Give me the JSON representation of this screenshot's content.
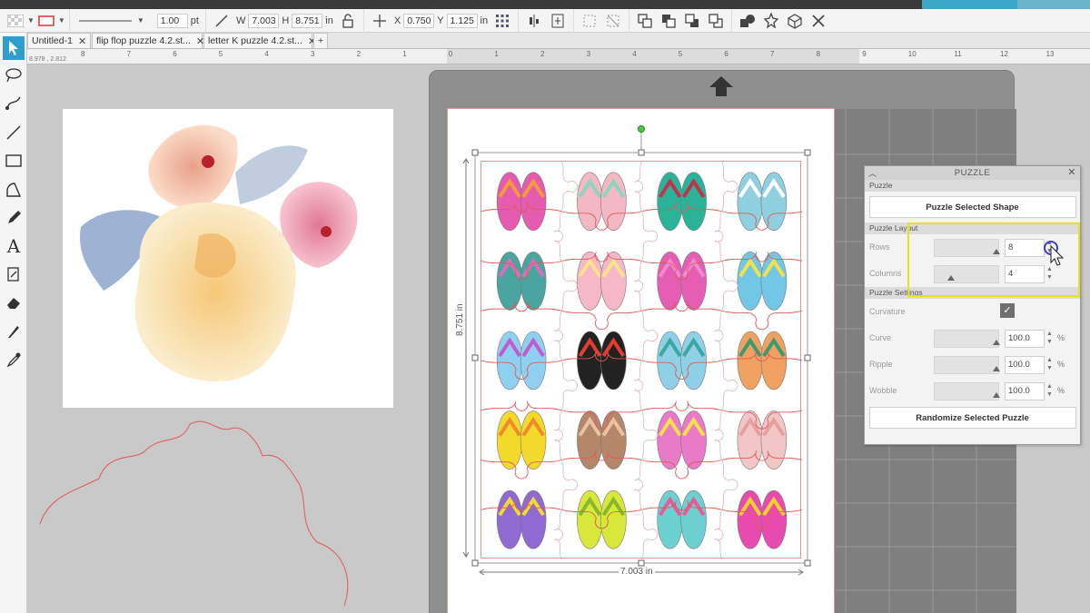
{
  "toolbar": {
    "line_width": "1.00",
    "line_unit": "pt",
    "w_label": "W",
    "w_value": "7.003",
    "h_label": "H",
    "h_value": "8.751",
    "size_unit": "in",
    "x_label": "X",
    "x_value": "0.750",
    "y_label": "Y",
    "y_value": "1.125",
    "pos_unit": "in"
  },
  "tabs": [
    {
      "label": "Untitled-1"
    },
    {
      "label": "flip flop puzzle 4.2.st..."
    },
    {
      "label": "letter K puzzle 4.2.st..."
    }
  ],
  "tab_add": "+",
  "tab_close": "✕",
  "ruler": {
    "coord": "8.978 , 2.812",
    "numbers": [
      "8",
      "7",
      "6",
      "5",
      "4",
      "3",
      "2",
      "1",
      "0",
      "1",
      "2",
      "3",
      "4",
      "5",
      "6",
      "7",
      "8",
      "9",
      "10",
      "11",
      "12",
      "13",
      "14"
    ]
  },
  "canvas": {
    "height_label": "8.751 in",
    "width_label": "7.003 in"
  },
  "panel": {
    "title": "PUZZLE",
    "section_puzzle": "Puzzle",
    "puzzle_button": "Puzzle Selected Shape",
    "section_layout": "Puzzle Layout",
    "rows_label": "Rows",
    "rows_value": "8",
    "columns_label": "Columns",
    "columns_value": "4",
    "section_settings": "Puzzle Settings",
    "curvature_label": "Curvature",
    "curve_label": "Curve",
    "curve_value": "100.0",
    "ripple_label": "Ripple",
    "ripple_value": "100.0",
    "wobble_label": "Wobble",
    "wobble_value": "100.0",
    "percent": "%",
    "randomize_button": "Randomize Selected Puzzle"
  },
  "colors": {
    "accent": "#2f9fd0",
    "highlight": "#e8e21a",
    "cut_line": "#e05a5a"
  }
}
